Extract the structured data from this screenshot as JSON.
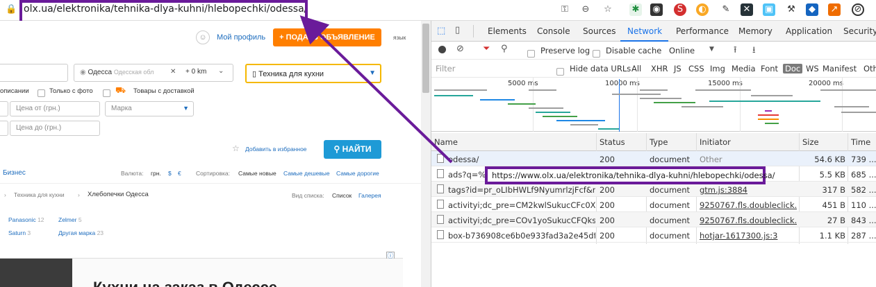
{
  "browser": {
    "url": "olx.ua/elektronika/tehnika-dlya-kuhni/hlebopechki/odessa/",
    "extensions": [
      "key-icon",
      "zoom-icon",
      "star-icon"
    ]
  },
  "olx": {
    "profile_label": "Мой профиль",
    "post_ad_label": "+ ПОДАТЬ ОБЪЯВЛЕНИЕ",
    "lang_label": "язык",
    "location_city": "Одесса",
    "location_region": "Одесская обл",
    "radius": "+ 0 km",
    "category": "Техника для кухни",
    "opt_descriptions": "описании",
    "opt_photo": "Только с фото",
    "opt_delivery": "Товары с доставкой",
    "price_from_placeholder": "Цена от (грн.)",
    "price_to_placeholder": "Цена до (грн.)",
    "brand_placeholder": "Марка",
    "add_favorite": "Добавить в избранное",
    "search_button": "НАЙТИ",
    "business": "Бизнес",
    "currency_label": "Валюта:",
    "currency_grn": "грн.",
    "currency_usd": "$",
    "currency_eur": "€",
    "sort_label": "Сортировка:",
    "sort_newest": "Самые новые",
    "sort_cheapest": "Самые дешевые",
    "sort_expensive": "Самые дорогие",
    "breadcrumb_1": "Техника для кухни",
    "breadcrumb_2": "Хлебопечки Одесса",
    "view_label": "Вид списка:",
    "view_list": "Список",
    "view_gallery": "Галерея",
    "brands": [
      {
        "name": "Panasonic",
        "count": "12"
      },
      {
        "name": "Zelmer",
        "count": "5"
      },
      {
        "name": "Saturn",
        "count": "3"
      },
      {
        "name": "Другая марка",
        "count": "23"
      }
    ],
    "ad_title": "Кухни на заказ в Одессе"
  },
  "devtools": {
    "tabs": [
      "Elements",
      "Console",
      "Sources",
      "Network",
      "Performance",
      "Memory",
      "Application",
      "Security"
    ],
    "active_tab": "Network",
    "preserve_log": "Preserve log",
    "disable_cache": "Disable cache",
    "throttle": "Online",
    "filter_placeholder": "Filter",
    "hide_data_urls": "Hide data URLs",
    "type_filters": [
      "All",
      "XHR",
      "JS",
      "CSS",
      "Img",
      "Media",
      "Font",
      "Doc",
      "WS",
      "Manifest",
      "Oth"
    ],
    "active_filter": "Doc",
    "timeline_ticks": [
      "5000 ms",
      "10000 ms",
      "15000 ms",
      "20000 ms"
    ],
    "columns": [
      "Name",
      "Status",
      "Type",
      "Initiator",
      "Size",
      "Time"
    ],
    "rows": [
      {
        "name": "odessa/",
        "status": "200",
        "type": "document",
        "initiator": "Other",
        "size": "54.6 KB",
        "time": "739 ..."
      },
      {
        "name": "ads?q=%D",
        "status": "200",
        "type": "document",
        "initiator": "",
        "size": "5.5 KB",
        "time": "685 ..."
      },
      {
        "name": "tags?id=pr_oLIbHWLf9NyumrlzjFcf&n...",
        "status": "200",
        "type": "document",
        "initiator": "gtm.js:3884",
        "size": "317 B",
        "time": "582 ..."
      },
      {
        "name": "activityi;dc_pre=CM2kwlSukucCFc0X4...",
        "status": "200",
        "type": "document",
        "initiator": "9250767.fls.doubleclick....",
        "size": "451 B",
        "time": "110 ..."
      },
      {
        "name": "activityi;dc_pre=COv1yoSukucCFQks4...",
        "status": "200",
        "type": "document",
        "initiator": "9250767.fls.doubleclick....",
        "size": "27 B",
        "time": "843 ..."
      },
      {
        "name": "box-b736908ce6b0e933fad3a2e45df6...",
        "status": "200",
        "type": "document",
        "initiator": "hotjar-1617300.js:3",
        "size": "1.1 KB",
        "time": "287 ..."
      }
    ],
    "tooltip": "https://www.olx.ua/elektronika/tehnika-dlya-kuhni/hlebopechki/odessa/"
  },
  "colors": {
    "annotation": "#6a1b9a",
    "olx_orange": "#ff7f00",
    "olx_teal": "#1e9ad6",
    "devtools_active": "#1a73e8"
  }
}
